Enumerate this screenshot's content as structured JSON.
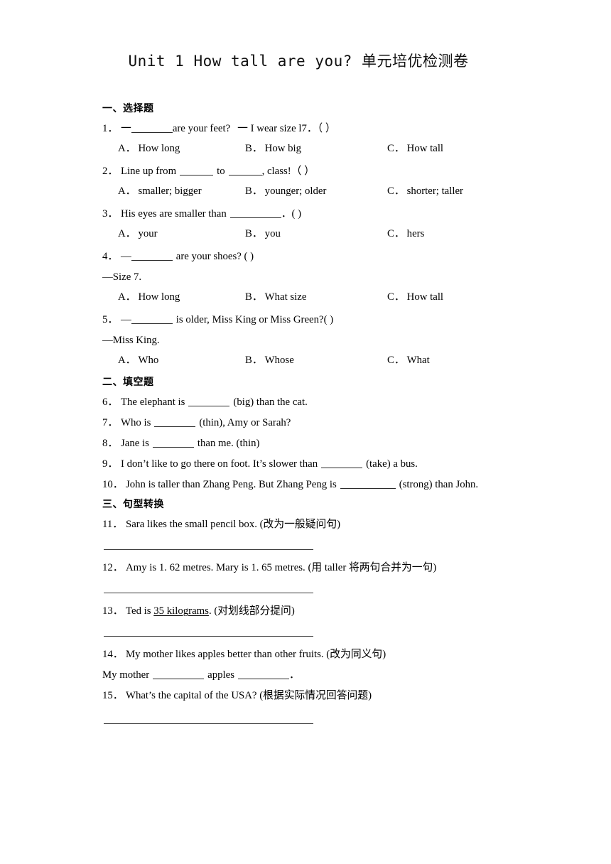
{
  "document": {
    "title": "Unit 1 How tall are you? 单元培优检测卷"
  },
  "sections": [
    {
      "heading": "一、选择题",
      "questions": [
        {
          "number": "1．",
          "prefix": "一",
          "text_after_blank": "are your feet?",
          "second_part": "一 I wear size l7．（  ）",
          "options": [
            {
              "label": "A．",
              "text": "How long"
            },
            {
              "label": "B．",
              "text": "How big"
            },
            {
              "label": "C．",
              "text": "How tall"
            }
          ]
        },
        {
          "number": "2．",
          "text_a": "Line up from",
          "text_b": "to",
          "text_c": ", class!（  ）",
          "options": [
            {
              "label": "A．",
              "text": "smaller; bigger"
            },
            {
              "label": "B．",
              "text": "younger; older"
            },
            {
              "label": "C．",
              "text": "shorter; taller"
            }
          ]
        },
        {
          "number": "3．",
          "text_a": "His eyes are smaller than",
          "text_b": "．(  )",
          "options": [
            {
              "label": "A．",
              "text": "your"
            },
            {
              "label": "B．",
              "text": "you"
            },
            {
              "label": "C．",
              "text": "hers"
            }
          ]
        },
        {
          "number": "4．",
          "prefix": "—",
          "text_after_blank": "are your shoes? (  )",
          "answer_line": "—Size 7.",
          "options": [
            {
              "label": "A．",
              "text": "How long"
            },
            {
              "label": "B．",
              "text": "What size"
            },
            {
              "label": "C．",
              "text": "How tall"
            }
          ]
        },
        {
          "number": "5．",
          "prefix": "—",
          "text_after_blank": "is older, Miss King or Miss Green?(   )",
          "answer_line": "—Miss King.",
          "options": [
            {
              "label": "A．",
              "text": "Who"
            },
            {
              "label": "B．",
              "text": "Whose"
            },
            {
              "label": "C．",
              "text": "What"
            }
          ]
        }
      ]
    },
    {
      "heading": "二、填空题",
      "questions": [
        {
          "number": "6．",
          "text_a": "The elephant is",
          "text_b": "(big) than the cat."
        },
        {
          "number": "7．",
          "text_a": "Who is",
          "text_b": "(thin), Amy or Sarah?"
        },
        {
          "number": "8．",
          "text_a": "Jane is",
          "text_b": "than me. (thin)"
        },
        {
          "number": "9．",
          "text_a": "I don’t like to go there on foot. It’s slower than",
          "text_b": "(take) a bus."
        },
        {
          "number": "10．",
          "text_a": "John is taller than Zhang Peng. But Zhang Peng is",
          "text_b": "(strong) than John."
        }
      ]
    },
    {
      "heading": "三、句型转换",
      "questions": [
        {
          "number": "11．",
          "text": "Sara likes the small pencil box. (改为一般疑问句)"
        },
        {
          "number": "12．",
          "text": "Amy is 1. 62 metres. Mary is 1. 65 metres. (用 taller 将两句合并为一句)"
        },
        {
          "number": "13．",
          "text_before": "Ted is ",
          "underlined": "35 kilograms",
          "text_after": ". (对划线部分提问)"
        },
        {
          "number": "14．",
          "text": "My mother likes apples better than other fruits. (改为同义句)",
          "fill_line": {
            "text_a": "My mother",
            "text_b": "apples",
            "text_c": "．"
          }
        },
        {
          "number": "15．",
          "text": "What’s the capital of the USA? (根据实际情况回答问题)"
        }
      ]
    }
  ]
}
